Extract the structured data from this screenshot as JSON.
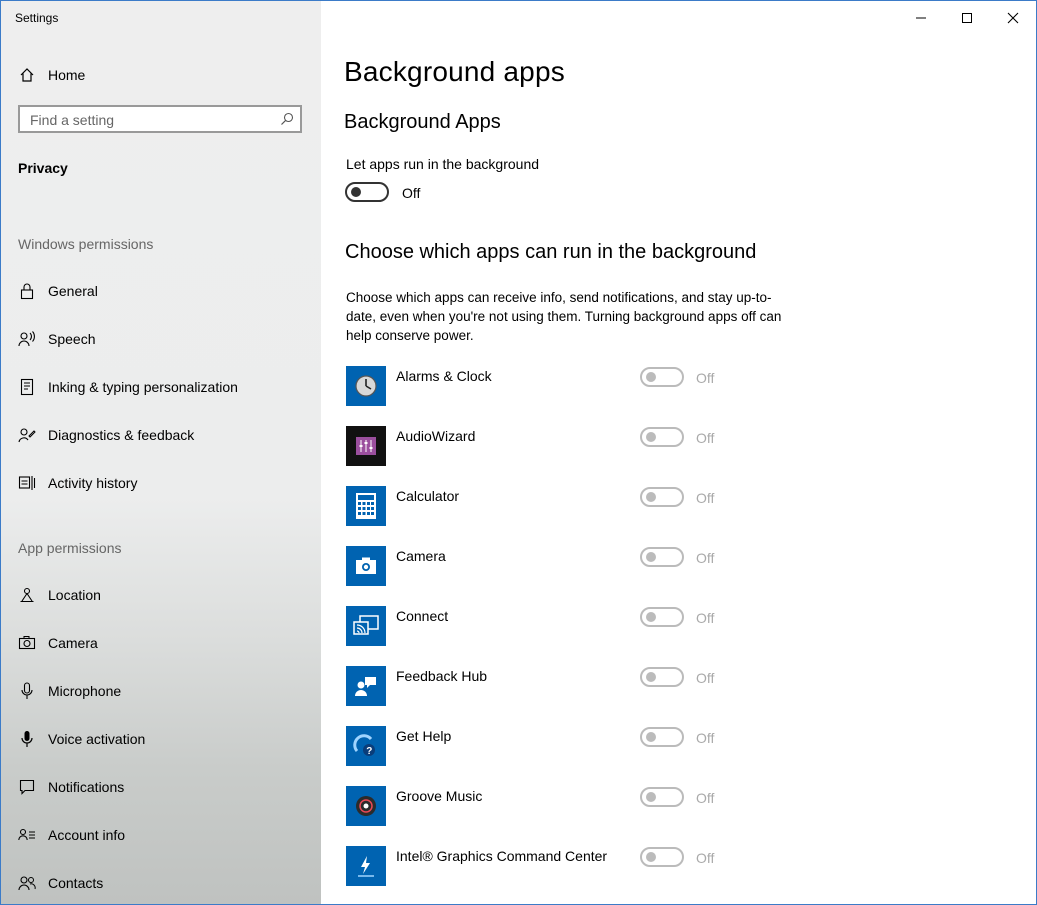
{
  "window": {
    "title": "Settings"
  },
  "sidebar": {
    "home_label": "Home",
    "search": {
      "placeholder": "Find a setting",
      "value": ""
    },
    "category": "Privacy",
    "sections": [
      {
        "header": "Windows permissions",
        "items": [
          {
            "label": "General",
            "icon": "lock-icon"
          },
          {
            "label": "Speech",
            "icon": "speech-icon"
          },
          {
            "label": "Inking & typing personalization",
            "icon": "inking-icon"
          },
          {
            "label": "Diagnostics & feedback",
            "icon": "diagnostics-icon"
          },
          {
            "label": "Activity history",
            "icon": "activity-history-icon"
          }
        ]
      },
      {
        "header": "App permissions",
        "items": [
          {
            "label": "Location",
            "icon": "location-icon"
          },
          {
            "label": "Camera",
            "icon": "camera-icon"
          },
          {
            "label": "Microphone",
            "icon": "microphone-icon"
          },
          {
            "label": "Voice activation",
            "icon": "voice-activation-icon"
          },
          {
            "label": "Notifications",
            "icon": "notifications-icon"
          },
          {
            "label": "Account info",
            "icon": "account-info-icon"
          },
          {
            "label": "Contacts",
            "icon": "contacts-icon"
          }
        ]
      }
    ]
  },
  "main": {
    "title": "Background apps",
    "subtitle": "Background Apps",
    "toggle_label": "Let apps run in the background",
    "toggle_state": "Off",
    "choose_heading": "Choose which apps can run in the background",
    "description": "Choose which apps can receive info, send notifications, and stay up-to-date, even when you're not using them. Turning background apps off can help conserve power.",
    "apps": [
      {
        "name": "Alarms & Clock",
        "state": "Off",
        "icon": "alarms-clock-icon",
        "color": "#0063b1"
      },
      {
        "name": "AudioWizard",
        "state": "Off",
        "icon": "audiowizard-icon",
        "color": "#1a1a1a"
      },
      {
        "name": "Calculator",
        "state": "Off",
        "icon": "calculator-icon",
        "color": "#0063b1"
      },
      {
        "name": "Camera",
        "state": "Off",
        "icon": "camera-app-icon",
        "color": "#0063b1"
      },
      {
        "name": "Connect",
        "state": "Off",
        "icon": "connect-icon",
        "color": "#0063b1"
      },
      {
        "name": "Feedback Hub",
        "state": "Off",
        "icon": "feedback-hub-icon",
        "color": "#0063b1"
      },
      {
        "name": "Get Help",
        "state": "Off",
        "icon": "get-help-icon",
        "color": "#0063b1"
      },
      {
        "name": "Groove Music",
        "state": "Off",
        "icon": "groove-music-icon",
        "color": "#0063b1"
      },
      {
        "name": "Intel® Graphics Command Center",
        "state": "Off",
        "icon": "intel-graphics-icon",
        "color": "#0063b1"
      }
    ]
  }
}
